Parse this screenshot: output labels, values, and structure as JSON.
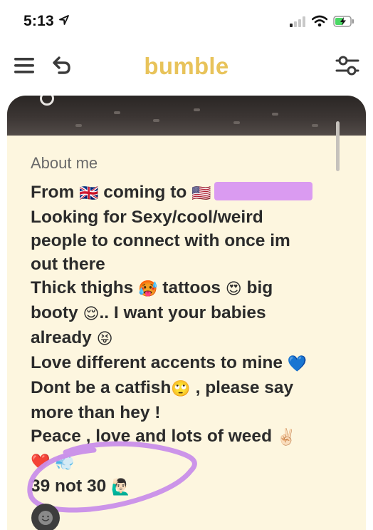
{
  "status_bar": {
    "time": "5:13",
    "icons": [
      "location-arrow-icon",
      "cellular-signal-icon",
      "wifi-icon",
      "battery-charging-icon"
    ]
  },
  "header": {
    "app_title": "bumble",
    "brand_color": "#e8c35a",
    "left_icons": [
      "menu-icon",
      "undo-icon"
    ],
    "right_icons": [
      "filter-icon"
    ]
  },
  "profile": {
    "section_heading": "About me",
    "bio_lines": [
      {
        "text_before": "From ",
        "emoji1": "🇬🇧",
        "text_mid": " coming to ",
        "emoji2": "🇺🇸",
        "redacted": true
      },
      {
        "text": "Looking for Sexy/cool/weird"
      },
      {
        "text": "people to connect with once im"
      },
      {
        "text": "out there"
      },
      {
        "text_before": "Thick thighs ",
        "emoji1": "🥵",
        "text_mid": " tattoos ",
        "emoji2": "😍",
        "text_after": " big"
      },
      {
        "text_before": "booty ",
        "emoji1": "😌",
        "text_after": ".. I want your babies"
      },
      {
        "text_before": "already ",
        "emoji1": "😝"
      },
      {
        "text_before": "Love different accents to mine ",
        "emoji1": "💙"
      },
      {
        "text_before": "Dont be a catfish",
        "emoji1": "🙄",
        "text_after": " , please say"
      },
      {
        "text": "more than hey !"
      },
      {
        "text_before": "Peace , love and lots of weed ",
        "emoji1": "✌🏻"
      },
      {
        "emoji1": "❤️",
        "emoji2": "💨"
      },
      {
        "text_before": "39 not 30 ",
        "emoji1": "🙋🏻‍♂️"
      }
    ],
    "highlight_color": "#c98ee9",
    "redaction_color": "#d792f2"
  }
}
